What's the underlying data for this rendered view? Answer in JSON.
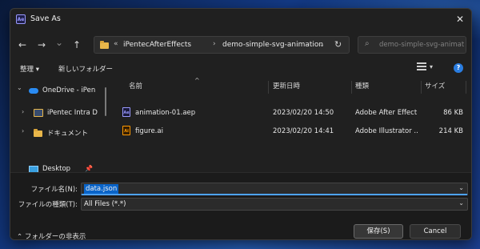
{
  "window": {
    "title": "Save As",
    "app_icon_text": "Ae"
  },
  "nav": {
    "back": "←",
    "forward": "→",
    "dropdown": "⌄",
    "up": "↑",
    "refresh": "↻",
    "address": {
      "overflow": "«",
      "crumbs": [
        "iPentecAfterEffects",
        "demo-simple-svg-animation"
      ],
      "separator": "›"
    },
    "search_placeholder": "demo-simple-svg-animation..."
  },
  "toolbar": {
    "organize": "整理 ▾",
    "new_folder": "新しいフォルダー"
  },
  "nav_pane": {
    "items": [
      {
        "label": "OneDrive - iPen",
        "chevron": "⌄"
      },
      {
        "label": "iPentec Intra D",
        "chevron": "›"
      },
      {
        "label": "ドキュメント",
        "chevron": "›"
      },
      {
        "label": "Desktop",
        "chevron": ""
      }
    ]
  },
  "files": {
    "columns": [
      "名前",
      "更新日時",
      "種類",
      "サイズ"
    ],
    "rows": [
      {
        "icon": "Ae",
        "name": "animation-01.aep",
        "date": "2023/02/20 14:50",
        "type": "Adobe After Effect...",
        "size": "86 KB"
      },
      {
        "icon": "Ai",
        "name": "figure.ai",
        "date": "2023/02/20 14:41",
        "type": "Adobe Illustrator ...",
        "size": "214 KB"
      }
    ]
  },
  "form": {
    "filename_label": "ファイル名(N):",
    "filename_value": "data.json",
    "filetype_label": "ファイルの種類(T):",
    "filetype_value": "All Files (*.*)",
    "hide_folders": "フォルダーの非表示",
    "save": "保存(S)",
    "cancel": "Cancel"
  },
  "colors": {
    "accent": "#0a64c8",
    "ae_icon": "#9999ff",
    "ai_icon": "#ff9a00",
    "folder": "#e8b64a"
  }
}
